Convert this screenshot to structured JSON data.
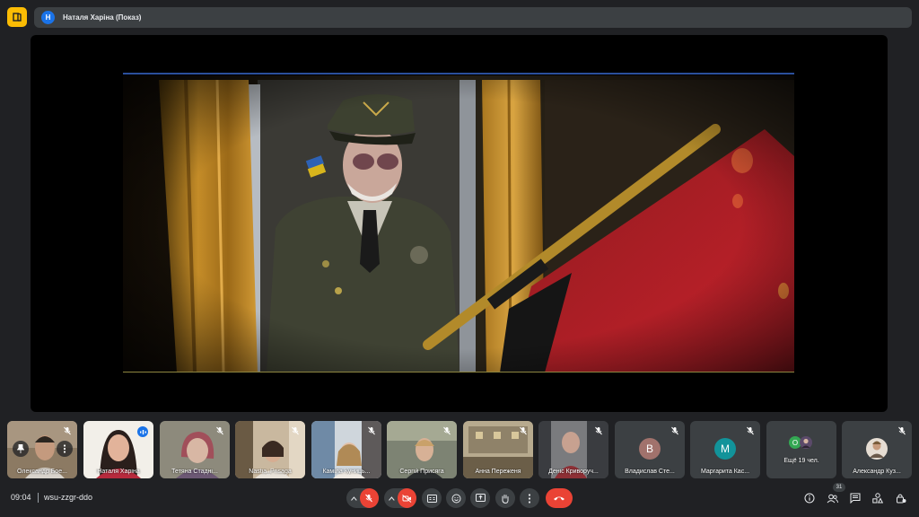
{
  "topbar": {
    "presenter_initial": "Н",
    "presenter_label": "Наталя Харіна (Показ)"
  },
  "participants": [
    {
      "name": "Олександр Бое...",
      "type": "video",
      "muted": true
    },
    {
      "name": "Наталя Харіна",
      "type": "video",
      "speaking": true
    },
    {
      "name": "Тетяна Стадні...",
      "type": "video",
      "muted": true
    },
    {
      "name": "Nastia_Prisaga",
      "type": "video",
      "muted": true
    },
    {
      "name": "Каміла Куниць...",
      "type": "video",
      "muted": true
    },
    {
      "name": "Сергій Присяга",
      "type": "video",
      "muted": true
    },
    {
      "name": "Анна Переженя",
      "type": "video",
      "muted": true
    },
    {
      "name": "Деніс Криворуч...",
      "type": "video",
      "muted": true
    },
    {
      "name": "Владислав Сте...",
      "type": "avatar",
      "initial": "В",
      "color": "#a1726c",
      "muted": true
    },
    {
      "name": "Маргарита Кас...",
      "type": "avatar",
      "initial": "M",
      "color": "#12939a",
      "muted": true
    },
    {
      "name": "Ещё 19 чел.",
      "type": "more",
      "initial": "O",
      "color": "#34a853"
    },
    {
      "name": "Александр Куз...",
      "type": "photo",
      "muted": true
    }
  ],
  "bottombar": {
    "time": "09:04",
    "meeting_code": "wsu-zzgr-ddo",
    "participants_count": "31"
  },
  "colors": {
    "background": "#202124",
    "control": "#3c4043",
    "danger": "#ea4335",
    "accent": "#1a73e8",
    "app_icon": "#fbbc04"
  },
  "icons": [
    "app-icon",
    "mic-off-icon",
    "camera-off-icon",
    "captions-icon",
    "emoji-icon",
    "present-icon",
    "raise-hand-icon",
    "more-options-icon",
    "hang-up-icon",
    "info-icon",
    "people-icon",
    "chat-icon",
    "activities-icon",
    "host-controls-icon",
    "pin-icon"
  ]
}
